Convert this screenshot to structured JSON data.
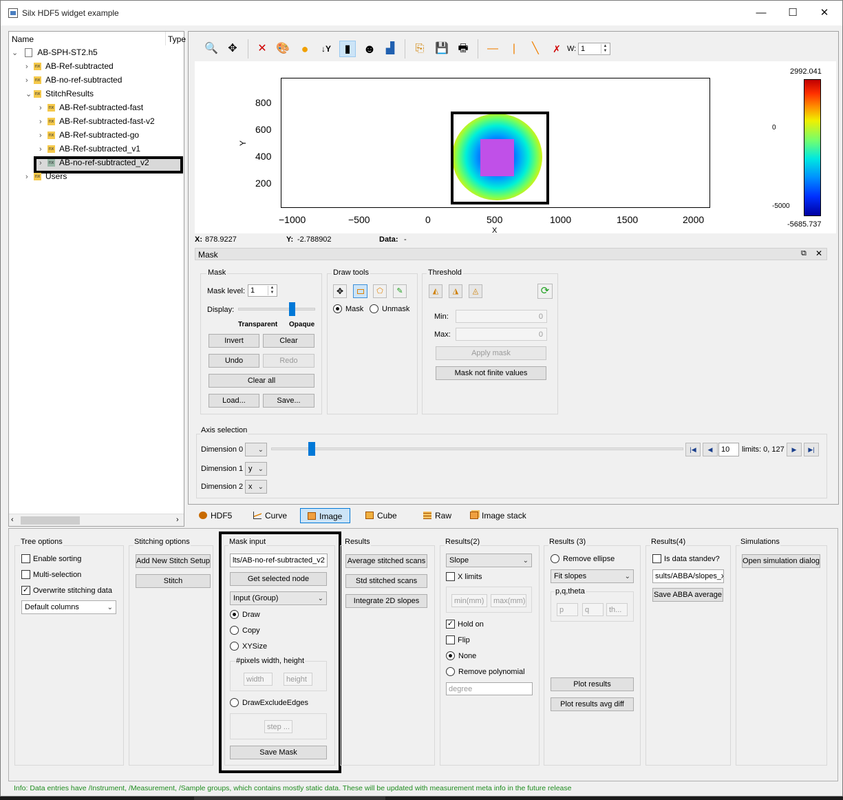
{
  "window": {
    "title": "Silx HDF5 widget example",
    "minimize": "—",
    "maximize": "☐",
    "close": "✕"
  },
  "tree": {
    "headers": [
      "Name",
      "Type"
    ],
    "root": "AB-SPH-ST2.h5",
    "items": [
      {
        "label": "AB-Ref-subtracted"
      },
      {
        "label": "AB-no-ref-subtracted"
      },
      {
        "label": "StitchResults"
      },
      {
        "label": "AB-Ref-subtracted-fast"
      },
      {
        "label": "AB-Ref-subtracted-fast-v2"
      },
      {
        "label": "AB-Ref-subtracted-go"
      },
      {
        "label": "AB-Ref-subtracted_v1"
      },
      {
        "label": "AB-no-ref-subtracted_v2"
      },
      {
        "label": "Users"
      }
    ],
    "nx_badge": "nx"
  },
  "plot": {
    "y_ticks": [
      "800",
      "600",
      "400",
      "200"
    ],
    "x_ticks": [
      "−1000",
      "−500",
      "0",
      "500",
      "1000",
      "1500",
      "2000"
    ],
    "ylabel": "Y",
    "xlabel": "X",
    "colorbar": {
      "max": "2992.041",
      "mid": "0",
      "low": "-5000",
      "min": "-5685.737"
    },
    "w_label": "W:",
    "w_value": "1"
  },
  "status": {
    "x_label": "X:",
    "x_value": "878.9227",
    "y_label": "Y:",
    "y_value": "-2.788902",
    "data_label": "Data:",
    "data_value": "-"
  },
  "mask_panel": {
    "title": "Mask",
    "mask_group": "Mask",
    "mask_level_label": "Mask level:",
    "mask_level": "1",
    "display_label": "Display:",
    "display_level": 0.72,
    "transparent": "Transparent",
    "opaque": "Opaque",
    "invert": "Invert",
    "clear": "Clear",
    "undo": "Undo",
    "redo": "Redo",
    "clear_all": "Clear all",
    "load": "Load...",
    "save": "Save...",
    "draw_tools": "Draw tools",
    "mask_radio": "Mask",
    "unmask_radio": "Unmask",
    "threshold": "Threshold",
    "min_label": "Min:",
    "min_value": "0",
    "max_label": "Max:",
    "max_value": "0",
    "apply_mask": "Apply mask",
    "mask_not_finite": "Mask not finite values"
  },
  "axis_selection": {
    "title": "Axis selection",
    "dim0_label": "Dimension 0",
    "dim0_value": "",
    "dim0_position": 0.09,
    "dim1_label": "Dimension 1",
    "dim1_value": "y",
    "dim2_label": "Dimension 2",
    "dim2_value": "x",
    "frame": "10",
    "limits": "limits: 0, 127"
  },
  "tabs": [
    {
      "label": "HDF5"
    },
    {
      "label": "Curve"
    },
    {
      "label": "Image"
    },
    {
      "label": "Cube"
    },
    {
      "label": "Raw"
    },
    {
      "label": "Image stack"
    }
  ],
  "tree_options": {
    "title": "Tree options",
    "enable_sorting": "Enable sorting",
    "multi_selection": "Multi-selection",
    "overwrite": "Overwrite stitching data",
    "columns": "Default columns"
  },
  "stitching_options": {
    "title": "Stitching options",
    "add_setup": "Add New Stitch Setup",
    "stitch": "Stitch"
  },
  "mask_input": {
    "title": "Mask input",
    "path": "lts/AB-no-ref-subtracted_v2",
    "get_selected": "Get selected node",
    "input_combo": "Input (Group)",
    "draw": "Draw",
    "copy": "Copy",
    "xysize": "XYSize",
    "pixels_group": "#pixels width, height",
    "width_ph": "width",
    "height_ph": "height",
    "draw_exclude": "DrawExcludeEdges",
    "step_ph": "step ...",
    "save_mask": "Save Mask"
  },
  "results": {
    "title": "Results",
    "avg": "Average stitched scans",
    "std": "Std stitched scans",
    "integrate": "Integrate 2D slopes"
  },
  "results2": {
    "title": "Results(2)",
    "combo": "Slope",
    "xlimits": "X limits",
    "min_ph": "min(mm)",
    "max_ph": "max(mm)",
    "hold_on": "Hold on",
    "flip": "Flip",
    "none": "None",
    "remove_poly": "Remove polynomial",
    "degree_ph": "degree"
  },
  "results3": {
    "title": "Results (3)",
    "remove_ellipse": "Remove ellipse",
    "fit_combo": "Fit slopes",
    "pqt": "p,q,theta",
    "p_ph": "p",
    "q_ph": "q",
    "th_ph": "th...",
    "plot_results": "Plot results",
    "plot_avg": "Plot results avg  diff"
  },
  "results4": {
    "title": "Results(4)",
    "is_std": "Is data standev?",
    "path": "sults/ABBA/slopes_x",
    "save_abba": "Save ABBA average"
  },
  "simulations": {
    "title": "Simulations",
    "open": "Open simulation dialog"
  },
  "info": "Info: Data entries have /Instrument, /Measurement, /Sample groups, which contains mostly static data. These will be updated with measurement meta info in the future release",
  "colors": {
    "info_text": "#1e8c1e",
    "accent": "#0078d7",
    "selected_tab": "#cce4f7"
  }
}
